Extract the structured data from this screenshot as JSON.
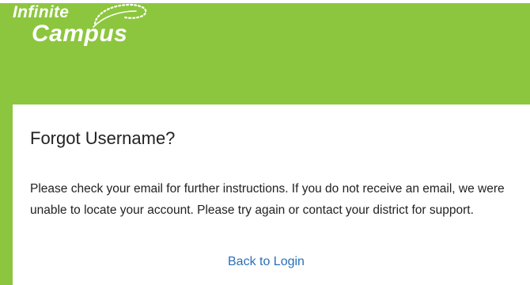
{
  "brand": {
    "line1": "Infinite",
    "line2": "Campus",
    "accent_color": "#8cc63e"
  },
  "card": {
    "title": "Forgot Username?",
    "message": "Please check your email for further instructions. If you do not receive an email, we were unable to locate your account. Please try again or contact your district for support.",
    "back_link": "Back to Login",
    "link_color": "#2a6fb8"
  }
}
